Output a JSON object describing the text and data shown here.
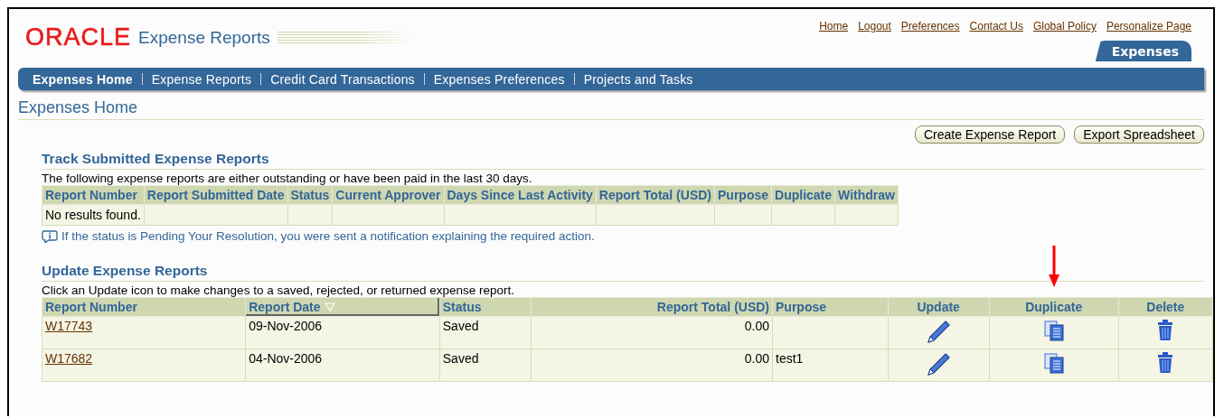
{
  "header": {
    "logo": "ORACLE",
    "app_title": "Expense Reports",
    "global_links": [
      "Home",
      "Logout",
      "Preferences",
      "Contact Us",
      "Global Policy",
      "Personalize Page"
    ],
    "tab": "Expenses"
  },
  "nav": [
    {
      "label": "Expenses Home",
      "selected": true
    },
    {
      "label": "Expense Reports",
      "selected": false
    },
    {
      "label": "Credit Card Transactions",
      "selected": false
    },
    {
      "label": "Expenses Preferences",
      "selected": false
    },
    {
      "label": "Projects and Tasks",
      "selected": false
    }
  ],
  "page_title": "Expenses Home",
  "buttons": [
    "Create Expense Report",
    "Export Spreadsheet"
  ],
  "track": {
    "title": "Track Submitted Expense Reports",
    "description": "The following expense reports are either outstanding or have been paid in the last 30 days.",
    "columns": [
      "Report Number",
      "Report Submitted Date",
      "Status",
      "Current Approver",
      "Days Since Last Activity",
      "Report Total (USD)",
      "Purpose",
      "Duplicate",
      "Withdraw"
    ],
    "empty_message": "No results found.",
    "tip": "If the status is Pending Your Resolution, you were sent a notification explaining the required action."
  },
  "update": {
    "title": "Update Expense Reports",
    "description": "Click an Update icon to make changes to a saved, rejected, or returned expense report.",
    "columns": [
      {
        "label": "Report Number",
        "sorted": false
      },
      {
        "label": "Report Date",
        "sorted": true
      },
      {
        "label": "Status",
        "sorted": false
      },
      {
        "label": "Report Total (USD)",
        "sorted": false
      },
      {
        "label": "Purpose",
        "sorted": false
      },
      {
        "label": "Update",
        "sorted": false
      },
      {
        "label": "Duplicate",
        "sorted": false
      },
      {
        "label": "Delete",
        "sorted": false
      }
    ],
    "rows": [
      {
        "report_number": "W17743",
        "report_date": "09-Nov-2006",
        "status": "Saved",
        "total": "0.00"
      },
      {
        "report_number": "W17682",
        "report_date": "04-Nov-2006",
        "status": "Saved",
        "total": "0.00",
        "purpose": "test1"
      }
    ]
  }
}
